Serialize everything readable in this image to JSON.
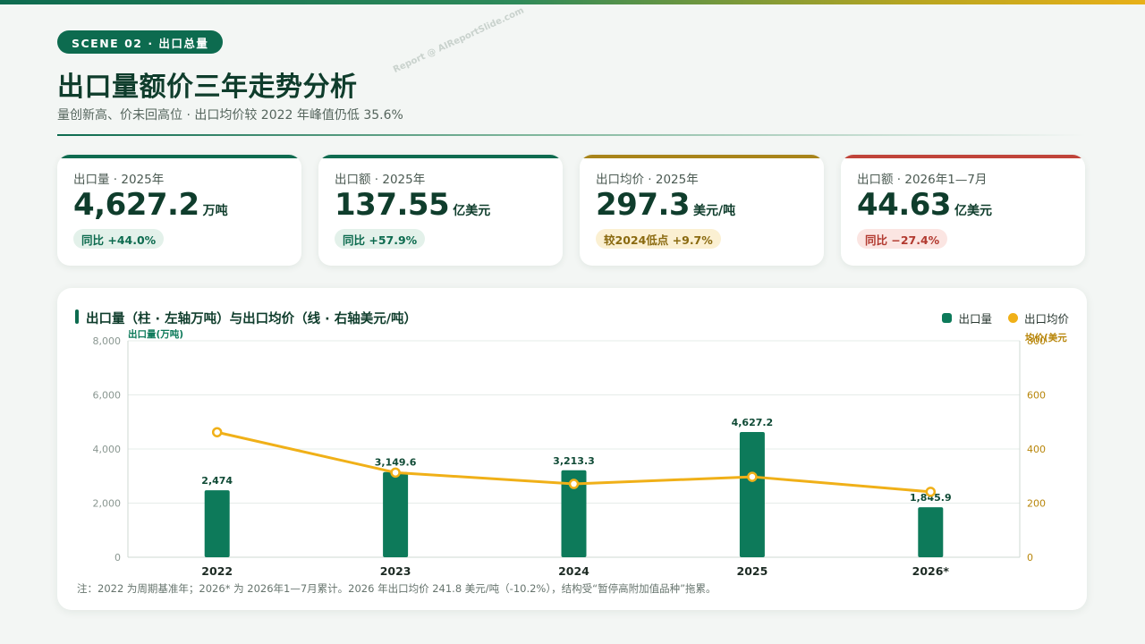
{
  "header": {
    "scene_label": "SCENE 02 · 出口总量",
    "title": "出口量额价三年走势分析",
    "subtitle": "量创新高、价未回高位 · 出口均价较 2022 年峰值仍低 35.6%",
    "watermark": "Report @ AIReportSlide.com"
  },
  "kpis": [
    {
      "label": "出口量 · 2025年",
      "value": "4,627.2",
      "unit": "万吨",
      "badge": "同比 +44.0%",
      "accent": "#0d6b4f",
      "badge_bg": "#e3f1ea",
      "badge_fg": "#0d6b4f"
    },
    {
      "label": "出口额 · 2025年",
      "value": "137.55",
      "unit": "亿美元",
      "badge": "同比 +57.9%",
      "accent": "#0d6b4f",
      "badge_bg": "#e3f1ea",
      "badge_fg": "#0d6b4f"
    },
    {
      "label": "出口均价 · 2025年",
      "value": "297.3",
      "unit": "美元/吨",
      "badge": "较2024低点 +9.7%",
      "accent": "#a8841a",
      "badge_bg": "#fbf0d2",
      "badge_fg": "#8a6a10"
    },
    {
      "label": "出口额 · 2026年1—7月",
      "value": "44.63",
      "unit": "亿美元",
      "badge": "同比 −27.4%",
      "accent": "#c0443a",
      "badge_bg": "#fbe5e2",
      "badge_fg": "#b23a30"
    }
  ],
  "chart": {
    "title": "出口量（柱 · 左轴万吨）与出口均价（线 · 右轴美元/吨）",
    "legend": [
      {
        "label": "出口量",
        "color": "#0d7a5a"
      },
      {
        "label": "出口均价",
        "color": "#f0b018"
      }
    ],
    "note": "注：2022 为周期基准年；2026* 为 2026年1—7月累计。2026 年出口均价 241.8 美元/吨（-10.2%），结构受“暂停高附加值品种”拖累。"
  },
  "chart_data": {
    "type": "bar",
    "categories": [
      "2022",
      "2023",
      "2024",
      "2025",
      "2026*"
    ],
    "series": [
      {
        "name": "出口量",
        "type": "bar",
        "axis": "left",
        "color": "#0d7a5a",
        "values": [
          2474,
          3149.6,
          3213.3,
          4627.2,
          1845.9
        ],
        "labels": [
          "2,474",
          "3,149.6",
          "3,213.3",
          "4,627.2",
          "1,845.9"
        ]
      },
      {
        "name": "出口均价",
        "type": "line",
        "axis": "right",
        "color": "#f0b018",
        "values": [
          462,
          313,
          271,
          297.3,
          241.8
        ]
      }
    ],
    "ylabel_left": "出口量(万吨)",
    "ylabel_right": "均价(美元",
    "ylim_left": [
      0,
      8000
    ],
    "ylim_right": [
      0,
      800
    ],
    "yticks_left": [
      "0",
      "2,000",
      "4,000",
      "6,000",
      "8,000"
    ],
    "yticks_right": [
      "0",
      "200",
      "400",
      "600",
      "800"
    ],
    "grid": true,
    "legend_position": "top-right"
  }
}
